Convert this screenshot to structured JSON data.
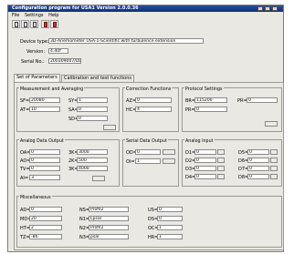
{
  "window": {
    "title": "Configuration program for USA1 Version 2.0.0.36"
  },
  "menu": [
    "File",
    "Settings",
    "Help"
  ],
  "toolbar": [
    {
      "icon": "new-file-icon"
    },
    {
      "icon": "open-file-icon"
    },
    {
      "icon": "save-file-icon"
    },
    {
      "icon": "read-device-icon"
    },
    {
      "icon": "write-device-icon"
    }
  ],
  "device": {
    "type_label": "Device type:",
    "type_value": "3D-Anemometer USA-1-Scientific with turbulence extension",
    "version_label": "Version:",
    "version_value": "4.40f",
    "serial_label": "Serial No.:",
    "serial_value": "200309007/DL"
  },
  "tabs": [
    {
      "label": "Set of Parameters"
    },
    {
      "label": "Calibration and test functions"
    }
  ],
  "measurement": {
    "title": "Measurement and Averaging",
    "fields": [
      {
        "label": "SF=",
        "value": "20080"
      },
      {
        "label": "SY=",
        "value": "1"
      },
      {
        "label": "AT=",
        "value": "10"
      },
      {
        "label": "SA=",
        "value": "0"
      },
      {
        "label": "SD=",
        "value": "0"
      }
    ]
  },
  "correction": {
    "title": "Correction Functions",
    "fields": [
      {
        "label": "AZ=",
        "value": "0"
      },
      {
        "label": "HC=",
        "value": "4"
      }
    ]
  },
  "protocol": {
    "title": "Protocol Settings",
    "fields": [
      {
        "label": "BR=",
        "value": "115200"
      },
      {
        "label": "PR=",
        "value": "0"
      },
      {
        "label": "PR=",
        "value": "0"
      }
    ]
  },
  "analog_out": {
    "title": "Analog Data Output",
    "fields": [
      {
        "label": "OA=",
        "value": "0"
      },
      {
        "label": "3K=",
        "value": "3000"
      },
      {
        "label": "AO=",
        "value": "0"
      },
      {
        "label": "2K=",
        "value": "500"
      },
      {
        "label": "TV=",
        "value": "0"
      },
      {
        "label": "3K=",
        "value": "4000"
      },
      {
        "label": "AI=",
        "value": "3"
      }
    ]
  },
  "serial_out": {
    "title": "Serial Data Output",
    "fields": [
      {
        "label": "OD=",
        "value": "0"
      },
      {
        "label": "OI=",
        "value": "1"
      }
    ]
  },
  "analog_in": {
    "title": "Analog Input",
    "fields": [
      {
        "label": "D1=",
        "value": "0"
      },
      {
        "label": "D5=",
        "value": "0"
      },
      {
        "label": "D2=",
        "value": "0"
      },
      {
        "label": "D6=",
        "value": "0"
      },
      {
        "label": "D3=",
        "value": "0"
      },
      {
        "label": "D7=",
        "value": "0"
      },
      {
        "label": "D4=",
        "value": "0"
      },
      {
        "label": "D8=",
        "value": "0"
      }
    ]
  },
  "misc": {
    "title": "Miscellaneous",
    "fields": [
      {
        "label": "AD=",
        "value": "0"
      },
      {
        "label": "NS=",
        "value": "Profil2"
      },
      {
        "label": "US=",
        "value": "0"
      },
      {
        "label": "MD=",
        "value": "20"
      },
      {
        "label": "N1=",
        "value": "Lpsal"
      },
      {
        "label": "DS=",
        "value": "0"
      },
      {
        "label": "HT=",
        "value": "2"
      },
      {
        "label": "N2=",
        "value": "Profil2"
      },
      {
        "label": "OC=",
        "value": "1"
      },
      {
        "label": "TZ=",
        "value": "-86"
      },
      {
        "label": "N3=",
        "value": "psal"
      },
      {
        "label": "HR=",
        "value": "1"
      }
    ]
  }
}
